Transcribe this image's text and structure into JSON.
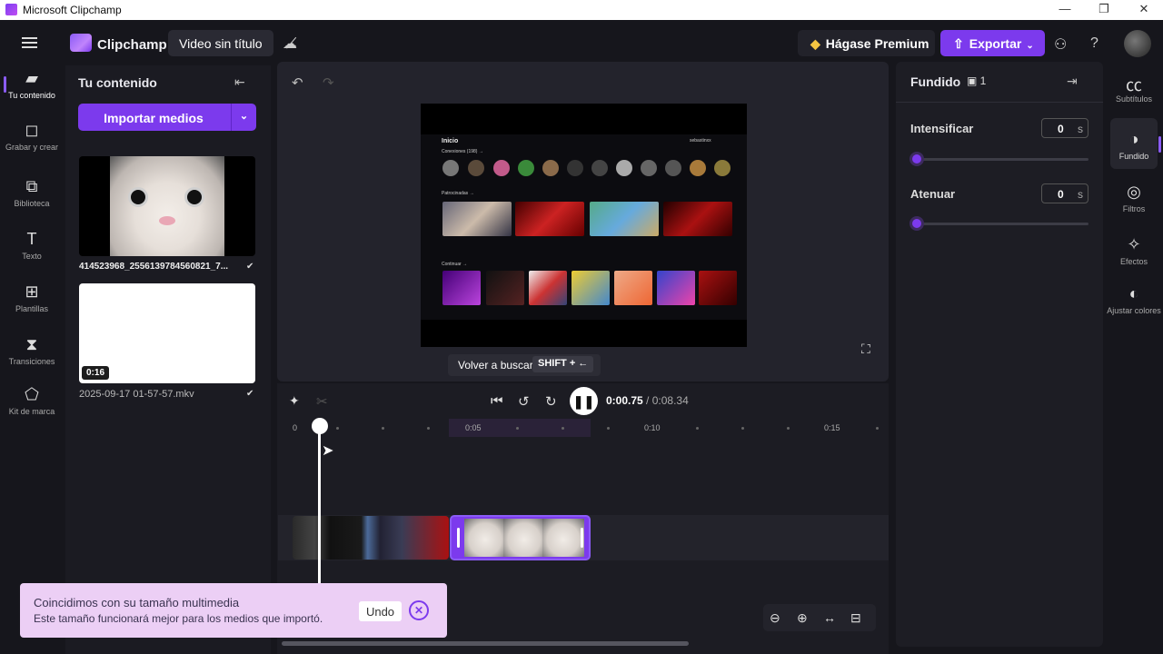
{
  "window": {
    "title": "Microsoft Clipchamp",
    "minimize": "—",
    "restore": "❐",
    "close": "✕"
  },
  "header": {
    "brand": "Clipchamp",
    "video_title": "Video sin título",
    "premium_label": "Hágase Premium",
    "export_label": "Exportar",
    "icons": [
      "menu-icon",
      "cloud-off-icon",
      "share-icon",
      "help-icon"
    ]
  },
  "left_rail": {
    "items": [
      {
        "label": "Tu contenido",
        "icon": "folder-icon",
        "glyph": "▰"
      },
      {
        "label": "Grabar y crear",
        "icon": "camera-icon",
        "glyph": "◻"
      },
      {
        "label": "Biblioteca",
        "icon": "library-icon",
        "glyph": "⧉"
      },
      {
        "label": "Texto",
        "icon": "text-icon",
        "glyph": "T"
      },
      {
        "label": "Plantillas",
        "icon": "templates-icon",
        "glyph": "⊞"
      },
      {
        "label": "Transiciones",
        "icon": "transitions-icon",
        "glyph": "⧗"
      },
      {
        "label": "Kit de marca",
        "icon": "brand-kit-icon",
        "glyph": "⬠"
      }
    ]
  },
  "content_panel": {
    "title": "Tu contenido",
    "import_label": "Importar medios",
    "media": [
      {
        "filename": "414523968_2556139784560821_7...",
        "duration": ""
      },
      {
        "filename": "2025-09-17 01-57-57.mkv",
        "duration": "0:16"
      }
    ]
  },
  "preview": {
    "tooltip_label": "Volver a buscar",
    "tooltip_shortcut": "SHIFT + ←",
    "screen": {
      "home": "Inicio",
      "section1": "Conexiones (198) →",
      "section2": "Patrocinadas →",
      "section3": "Continuar →",
      "user": "sebastinxx"
    }
  },
  "playback": {
    "current_time": "0:00.75",
    "total_time": "/ 0:08.34",
    "ruler_labels": [
      "0",
      "0:05",
      "0:10",
      "0:15"
    ]
  },
  "toast": {
    "heading": "Coincidimos con su tamaño multimedia",
    "body": "Este tamaño funcionará mejor para los medios que importó.",
    "undo_label": "Undo"
  },
  "properties": {
    "title": "Fundido",
    "badge_count": "1",
    "fade_in_label": "Intensificar",
    "fade_in_value": "0",
    "fade_out_label": "Atenuar",
    "fade_out_value": "0",
    "unit": "s"
  },
  "right_rail": {
    "items": [
      {
        "label": "Subtítulos",
        "icon": "captions-icon",
        "glyph": "㏄"
      },
      {
        "label": "Fundido",
        "icon": "fade-icon",
        "glyph": "◑"
      },
      {
        "label": "Filtros",
        "icon": "filters-icon",
        "glyph": "◎"
      },
      {
        "label": "Efectos",
        "icon": "effects-icon",
        "glyph": "✧"
      },
      {
        "label": "Ajustar colores",
        "icon": "color-adjust-icon",
        "glyph": "◐"
      }
    ]
  },
  "colors": {
    "accent": "#7c3aed",
    "background": "#16161c",
    "toast": "#eccff5"
  }
}
